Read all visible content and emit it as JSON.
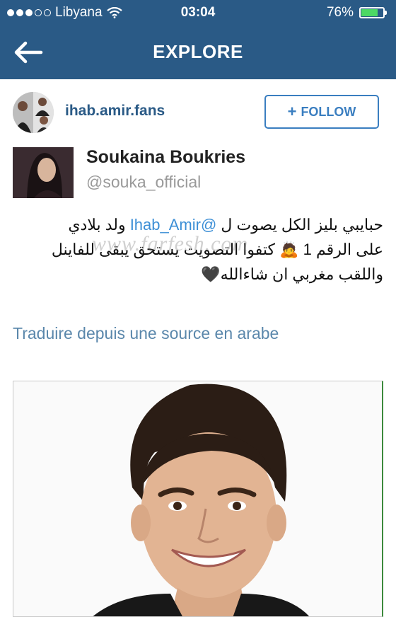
{
  "status_bar": {
    "carrier": "Libyana",
    "time": "03:04",
    "battery_percent": "76%",
    "battery_level": 0.76,
    "battery_color": "#4cd964",
    "signal_dots_filled": 3,
    "signal_dots_total": 5,
    "wifi_icon": "wifi-icon"
  },
  "nav": {
    "title": "EXPLORE",
    "back_icon": "back-arrow-icon",
    "bar_color": "#2a5a86"
  },
  "profile": {
    "username": "ihab.amir.fans",
    "follow_label": "FOLLOW",
    "follow_icon": "plus-icon",
    "accent_color": "#3a7ec0"
  },
  "tweet": {
    "name": "Soukaina Boukries",
    "handle": "@souka_official",
    "line1_before": "حبايبي بليز الكل يصوت ل ",
    "mention": "@Ihab_Amir",
    "line1_after": " ولد بلادي",
    "line2": "على الرقم 1 🙇 كتفوا التصويت يستحق يبقى للفاينل",
    "line3": "واللقب مغربي ان شاءالله🖤",
    "mention_color": "#3d8fd6"
  },
  "translate_label": "Traduire depuis une source en arabe",
  "watermark": "www.farfesh.com"
}
